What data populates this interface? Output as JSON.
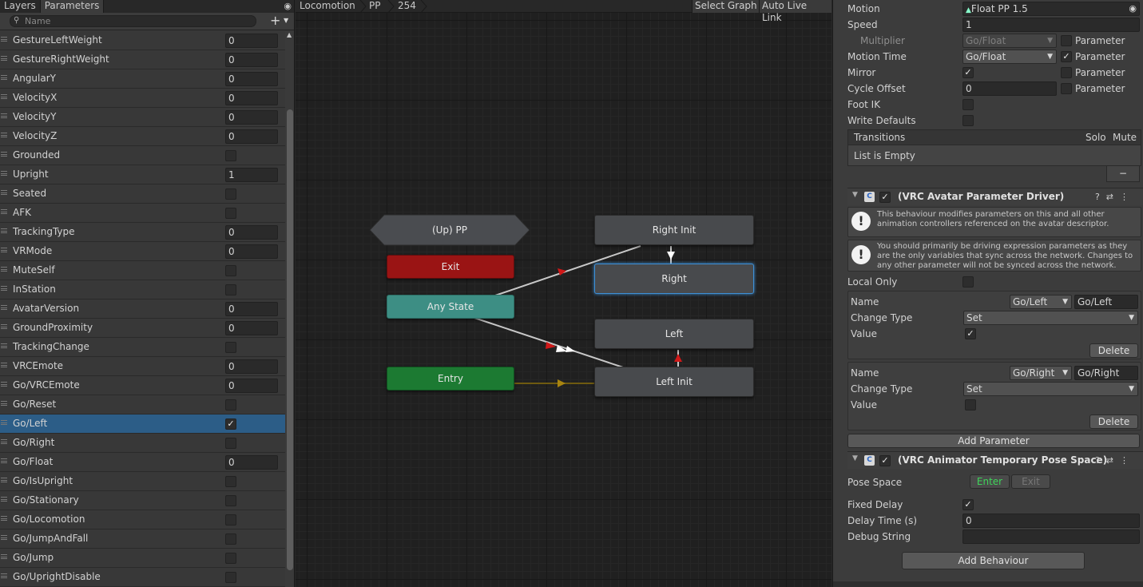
{
  "left_panel": {
    "tabs": [
      {
        "label": "Layers"
      },
      {
        "label": "Parameters"
      }
    ],
    "search_placeholder": "Name",
    "add_label": "+",
    "parameters": [
      {
        "name": "GestureLeftWeight",
        "type": "value",
        "value": "0"
      },
      {
        "name": "GestureRightWeight",
        "type": "value",
        "value": "0"
      },
      {
        "name": "AngularY",
        "type": "value",
        "value": "0"
      },
      {
        "name": "VelocityX",
        "type": "value",
        "value": "0"
      },
      {
        "name": "VelocityY",
        "type": "value",
        "value": "0"
      },
      {
        "name": "VelocityZ",
        "type": "value",
        "value": "0"
      },
      {
        "name": "Grounded",
        "type": "bool",
        "checked": false
      },
      {
        "name": "Upright",
        "type": "value",
        "value": "1"
      },
      {
        "name": "Seated",
        "type": "bool",
        "checked": false
      },
      {
        "name": "AFK",
        "type": "bool",
        "checked": false
      },
      {
        "name": "TrackingType",
        "type": "value",
        "value": "0"
      },
      {
        "name": "VRMode",
        "type": "value",
        "value": "0"
      },
      {
        "name": "MuteSelf",
        "type": "bool",
        "checked": false
      },
      {
        "name": "InStation",
        "type": "bool",
        "checked": false
      },
      {
        "name": "AvatarVersion",
        "type": "value",
        "value": "0"
      },
      {
        "name": "GroundProximity",
        "type": "value",
        "value": "0"
      },
      {
        "name": "TrackingChange",
        "type": "bool",
        "checked": false
      },
      {
        "name": "VRCEmote",
        "type": "value",
        "value": "0"
      },
      {
        "name": "Go/VRCEmote",
        "type": "value",
        "value": "0"
      },
      {
        "name": "Go/Reset",
        "type": "bool",
        "checked": false
      },
      {
        "name": "Go/Left",
        "type": "bool",
        "checked": true,
        "selected": true
      },
      {
        "name": "Go/Right",
        "type": "bool",
        "checked": false
      },
      {
        "name": "Go/Float",
        "type": "value",
        "value": "0"
      },
      {
        "name": "Go/IsUpright",
        "type": "bool",
        "checked": false
      },
      {
        "name": "Go/Stationary",
        "type": "bool",
        "checked": false
      },
      {
        "name": "Go/Locomotion",
        "type": "bool",
        "checked": false
      },
      {
        "name": "Go/JumpAndFall",
        "type": "bool",
        "checked": false
      },
      {
        "name": "Go/Jump",
        "type": "bool",
        "checked": false
      },
      {
        "name": "Go/UprightDisable",
        "type": "bool",
        "checked": false
      }
    ]
  },
  "graph": {
    "breadcrumbs": [
      "Locomotion",
      "PP",
      "254"
    ],
    "select_graph_label": "Select Graph",
    "auto_live_link_label": "Auto Live Link",
    "nodes": {
      "up_state": "(Up) PP",
      "exit": "Exit",
      "any_state": "Any State",
      "entry": "Entry",
      "right_init": "Right Init",
      "right": "Right",
      "left": "Left",
      "left_init": "Left Init"
    },
    "colors": {
      "exit": "#9a1414",
      "any_state": "#3d8e84",
      "entry": "#1c7a32",
      "selected_outline": "#3d8fd6",
      "transition_arrow": "#d01818"
    }
  },
  "inspector": {
    "motion_label": "Motion",
    "motion_value": "Float PP 1.5",
    "speed_label": "Speed",
    "speed_value": "1",
    "multiplier_label": "Multiplier",
    "multiplier_value": "Go/Float",
    "parameter_label": "Parameter",
    "motion_time_label": "Motion Time",
    "motion_time_value": "Go/Float",
    "mirror_label": "Mirror",
    "cycle_offset_label": "Cycle Offset",
    "cycle_offset_value": "0",
    "foot_ik_label": "Foot IK",
    "write_defaults_label": "Write Defaults",
    "transitions_header": "Transitions",
    "solo_label": "Solo",
    "mute_label": "Mute",
    "list_empty": "List is Empty",
    "minus_label": "−",
    "driver": {
      "title": "(VRC Avatar Parameter Driver)",
      "help1": "This behaviour modifies parameters on this and all other animation controllers referenced on the avatar descriptor.",
      "help2": "You should primarily be driving expression parameters as they are the only variables that sync across the network. Changes to any other parameter will not be synced across the network.",
      "local_only_label": "Local Only",
      "name_label": "Name",
      "change_type_label": "Change Type",
      "value_label": "Value",
      "delete_label": "Delete",
      "entries": [
        {
          "name_dropdown": "Go/Left",
          "name_text": "Go/Left",
          "change_type": "Set",
          "value_checked": true
        },
        {
          "name_dropdown": "Go/Right",
          "name_text": "Go/Right",
          "change_type": "Set",
          "value_checked": false
        }
      ],
      "add_parameter_label": "Add Parameter"
    },
    "pose_space": {
      "title": "(VRC Animator Temporary Pose Space)",
      "pose_space_label": "Pose Space",
      "enter_label": "Enter",
      "exit_label": "Exit",
      "fixed_delay_label": "Fixed Delay",
      "delay_time_label": "Delay Time (s)",
      "delay_time_value": "0",
      "debug_string_label": "Debug String",
      "debug_string_value": ""
    },
    "add_behaviour_label": "Add Behaviour"
  }
}
